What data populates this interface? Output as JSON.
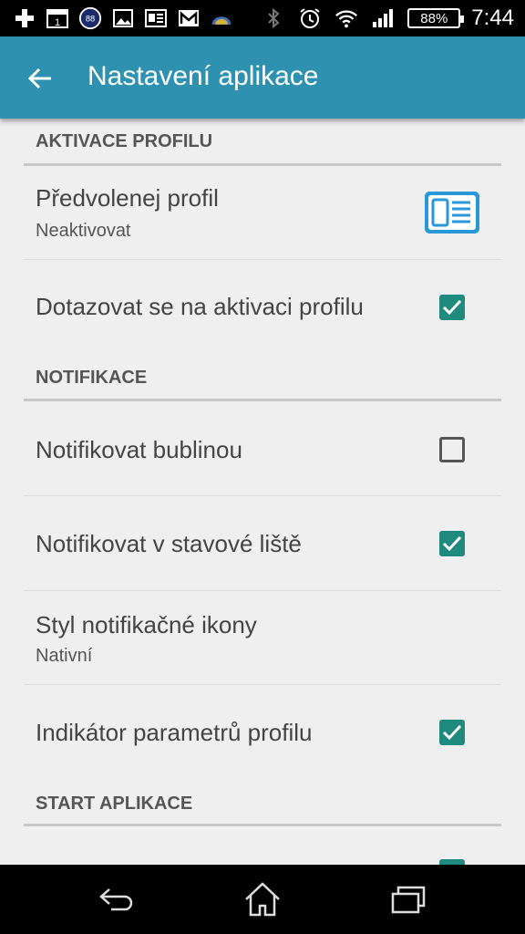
{
  "status_bar": {
    "time": "7:44",
    "battery": "88%",
    "calendar_day": "1",
    "badge_number": "88",
    "icons_left": [
      "plus-icon",
      "calendar-icon",
      "badge-icon",
      "image-icon",
      "news-icon",
      "mail-icon",
      "weather-icon"
    ],
    "icons_right": [
      "bluetooth-icon",
      "alarm-icon",
      "wifi-icon",
      "signal-icon",
      "battery-icon"
    ]
  },
  "toolbar": {
    "title": "Nastavení aplikace",
    "color": "#2e91b0"
  },
  "sections": {
    "profile_activation": {
      "header": "AKTIVACE PROFILU",
      "default_profile_title": "Předvolenej profil",
      "default_profile_summary": "Neaktivovat",
      "ask_activation_title": "Dotazovat se na aktivaci profilu",
      "ask_activation_checked": true
    },
    "notifications": {
      "header": "NOTIFIKACE",
      "bubble_title": "Notifikovat bublinou",
      "bubble_checked": false,
      "statusbar_title": "Notifikovat v stavové liště",
      "statusbar_checked": true,
      "icon_style_title": "Styl notifikačné ikony",
      "icon_style_summary": "Nativní",
      "indicator_title": "Indikátor parametrů profilu",
      "indicator_checked": true
    },
    "app_start": {
      "header": "START APLIKACE"
    }
  },
  "accent_color": "#1f8a7e"
}
